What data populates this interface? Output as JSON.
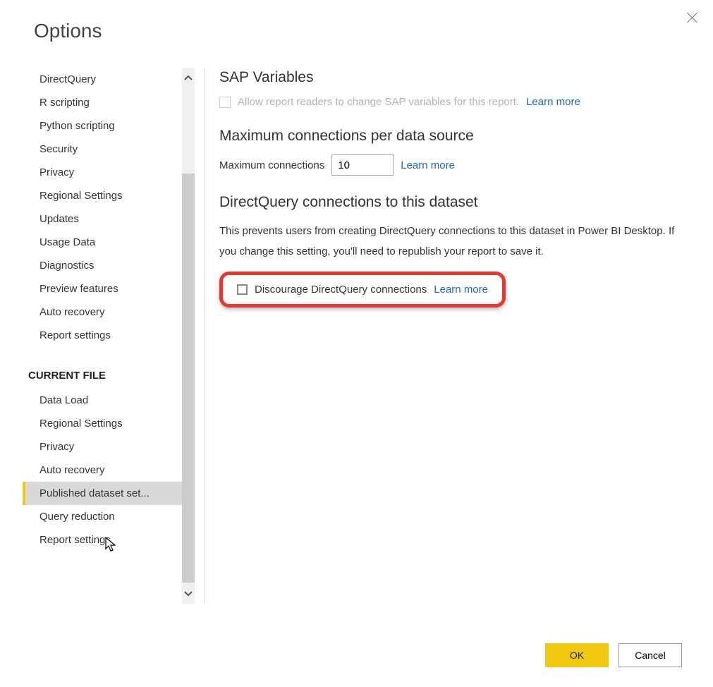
{
  "dialog": {
    "title": "Options"
  },
  "sidebar": {
    "global_items": [
      "DirectQuery",
      "R scripting",
      "Python scripting",
      "Security",
      "Privacy",
      "Regional Settings",
      "Updates",
      "Usage Data",
      "Diagnostics",
      "Preview features",
      "Auto recovery",
      "Report settings"
    ],
    "section_heading": "CURRENT FILE",
    "current_file_items": [
      "Data Load",
      "Regional Settings",
      "Privacy",
      "Auto recovery",
      "Published dataset set...",
      "Query reduction",
      "Report settings"
    ],
    "selected_index": 4
  },
  "content": {
    "sap": {
      "heading": "SAP Variables",
      "checkbox_label": "Allow report readers to change SAP variables for this report.",
      "learn_more": "Learn more"
    },
    "max_conn": {
      "heading": "Maximum connections per data source",
      "label": "Maximum connections",
      "value": "10",
      "learn_more": "Learn more"
    },
    "dq": {
      "heading": "DirectQuery connections to this dataset",
      "description": "This prevents users from creating DirectQuery connections to this dataset in Power BI Desktop. If you change this setting, you'll need to republish your report to save it.",
      "checkbox_label": "Discourage DirectQuery connections",
      "learn_more": "Learn more"
    }
  },
  "footer": {
    "ok": "OK",
    "cancel": "Cancel"
  }
}
